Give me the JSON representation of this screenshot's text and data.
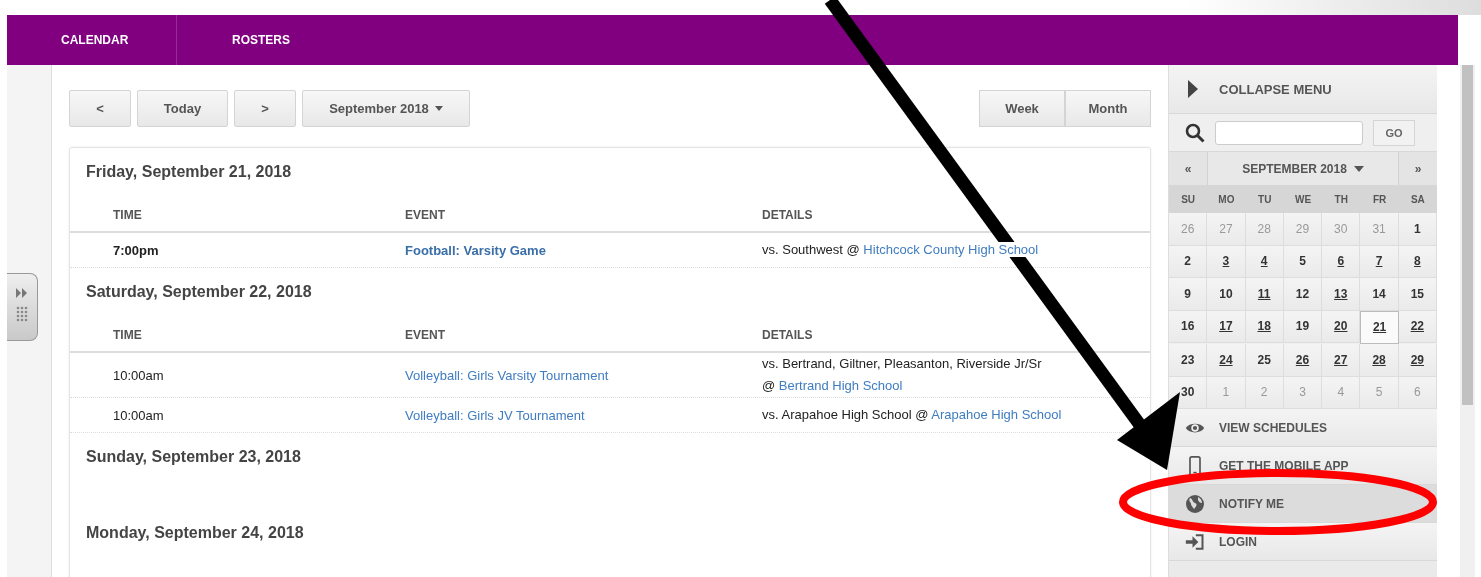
{
  "nav": {
    "tabs": [
      {
        "label": "CALENDAR"
      },
      {
        "label": "ROSTERS"
      }
    ]
  },
  "toolbar": {
    "nav_buttons": [
      "<",
      "Today",
      ">"
    ],
    "month_picker": "September 2018",
    "view_buttons": [
      "Week",
      "Month"
    ]
  },
  "days": [
    {
      "heading": "Friday, September 21, 2018",
      "columns": [
        "TIME",
        "EVENT",
        "DETAILS"
      ],
      "events": [
        {
          "time": "7:00pm",
          "event": "Football: Varsity Game",
          "emphasis": true,
          "details": "vs. Southwest",
          "venue_prefix": "@",
          "venue": "Hitchcock County High School"
        }
      ]
    },
    {
      "heading": "Saturday, September 22, 2018",
      "columns": [
        "TIME",
        "EVENT",
        "DETAILS"
      ],
      "events": [
        {
          "time": "10:00am",
          "event": "Volleyball: Girls Varsity Tournament",
          "emphasis": false,
          "details": "vs. Bertrand, Giltner, Pleasanton, Riverside Jr/Sr",
          "venue_prefix": "@",
          "venue": "Bertrand High School"
        },
        {
          "time": "10:00am",
          "event": "Volleyball: Girls JV Tournament",
          "emphasis": false,
          "details": "vs. Arapahoe High School",
          "venue_prefix": "@",
          "venue": "Arapahoe High School"
        }
      ]
    },
    {
      "heading": "Sunday, September 23, 2018"
    },
    {
      "heading": "Monday, September 24, 2018"
    }
  ],
  "sidebar": {
    "collapse": "COLLAPSE MENU",
    "search": {
      "button": "GO"
    },
    "calendar": {
      "prev": "«",
      "title": "SEPTEMBER 2018",
      "next": "»",
      "weekdays": [
        "SU",
        "MO",
        "TU",
        "WE",
        "TH",
        "FR",
        "SA"
      ],
      "weeks": [
        [
          {
            "day": "26",
            "in_month": false,
            "has_events": false,
            "selected": false
          },
          {
            "day": "27",
            "in_month": false,
            "has_events": false,
            "selected": false
          },
          {
            "day": "28",
            "in_month": false,
            "has_events": false,
            "selected": false
          },
          {
            "day": "29",
            "in_month": false,
            "has_events": false,
            "selected": false
          },
          {
            "day": "30",
            "in_month": false,
            "has_events": false,
            "selected": false
          },
          {
            "day": "31",
            "in_month": false,
            "has_events": false,
            "selected": false
          },
          {
            "day": "1",
            "in_month": true,
            "has_events": false,
            "selected": false
          }
        ],
        [
          {
            "day": "2",
            "in_month": true,
            "has_events": false,
            "selected": false
          },
          {
            "day": "3",
            "in_month": true,
            "has_events": true,
            "selected": false
          },
          {
            "day": "4",
            "in_month": true,
            "has_events": true,
            "selected": false
          },
          {
            "day": "5",
            "in_month": true,
            "has_events": false,
            "selected": false
          },
          {
            "day": "6",
            "in_month": true,
            "has_events": true,
            "selected": false
          },
          {
            "day": "7",
            "in_month": true,
            "has_events": true,
            "selected": false
          },
          {
            "day": "8",
            "in_month": true,
            "has_events": true,
            "selected": false
          }
        ],
        [
          {
            "day": "9",
            "in_month": true,
            "has_events": false,
            "selected": false
          },
          {
            "day": "10",
            "in_month": true,
            "has_events": false,
            "selected": false
          },
          {
            "day": "11",
            "in_month": true,
            "has_events": true,
            "selected": false
          },
          {
            "day": "12",
            "in_month": true,
            "has_events": false,
            "selected": false
          },
          {
            "day": "13",
            "in_month": true,
            "has_events": true,
            "selected": false
          },
          {
            "day": "14",
            "in_month": true,
            "has_events": false,
            "selected": false
          },
          {
            "day": "15",
            "in_month": true,
            "has_events": false,
            "selected": false
          }
        ],
        [
          {
            "day": "16",
            "in_month": true,
            "has_events": false,
            "selected": false
          },
          {
            "day": "17",
            "in_month": true,
            "has_events": true,
            "selected": false
          },
          {
            "day": "18",
            "in_month": true,
            "has_events": true,
            "selected": false
          },
          {
            "day": "19",
            "in_month": true,
            "has_events": false,
            "selected": false
          },
          {
            "day": "20",
            "in_month": true,
            "has_events": true,
            "selected": false
          },
          {
            "day": "21",
            "in_month": true,
            "has_events": true,
            "selected": true
          },
          {
            "day": "22",
            "in_month": true,
            "has_events": true,
            "selected": false
          }
        ],
        [
          {
            "day": "23",
            "in_month": true,
            "has_events": false,
            "selected": false
          },
          {
            "day": "24",
            "in_month": true,
            "has_events": true,
            "selected": false
          },
          {
            "day": "25",
            "in_month": true,
            "has_events": false,
            "selected": false
          },
          {
            "day": "26",
            "in_month": true,
            "has_events": true,
            "selected": false
          },
          {
            "day": "27",
            "in_month": true,
            "has_events": true,
            "selected": false
          },
          {
            "day": "28",
            "in_month": true,
            "has_events": true,
            "selected": false
          },
          {
            "day": "29",
            "in_month": true,
            "has_events": true,
            "selected": false
          }
        ],
        [
          {
            "day": "30",
            "in_month": true,
            "has_events": false,
            "selected": false
          },
          {
            "day": "1",
            "in_month": false,
            "has_events": false,
            "selected": false
          },
          {
            "day": "2",
            "in_month": false,
            "has_events": false,
            "selected": false
          },
          {
            "day": "3",
            "in_month": false,
            "has_events": false,
            "selected": false
          },
          {
            "day": "4",
            "in_month": false,
            "has_events": false,
            "selected": false
          },
          {
            "day": "5",
            "in_month": false,
            "has_events": false,
            "selected": false
          },
          {
            "day": "6",
            "in_month": false,
            "has_events": false,
            "selected": false
          }
        ]
      ]
    },
    "menu": [
      {
        "label": "VIEW SCHEDULES",
        "kind": "eye",
        "highlighted": false
      },
      {
        "label": "GET THE MOBILE APP",
        "kind": "phone",
        "highlighted": false
      },
      {
        "label": "NOTIFY ME",
        "kind": "globe",
        "highlighted": true
      },
      {
        "label": "LOGIN",
        "kind": "login",
        "highlighted": false
      }
    ]
  }
}
